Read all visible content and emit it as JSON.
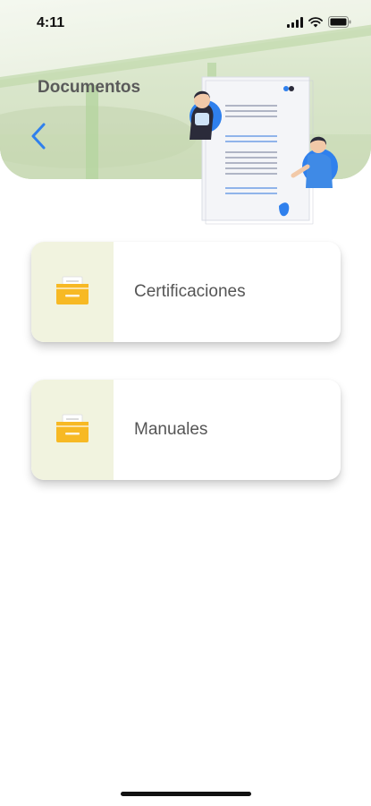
{
  "status_bar": {
    "time": "4:11",
    "icons": [
      "signal-icon",
      "wifi-icon",
      "battery-icon"
    ]
  },
  "header": {
    "title": "Documentos",
    "back_icon": "chevron-left-icon"
  },
  "documents": [
    {
      "label": "Certificaciones",
      "icon": "folder-documents-icon"
    },
    {
      "label": "Manuales",
      "icon": "folder-documents-icon"
    }
  ],
  "colors": {
    "accent": "#2f80ed",
    "folder": "#f7b924",
    "icon_tile_bg": "#f1f3df",
    "label_text": "#555555"
  }
}
